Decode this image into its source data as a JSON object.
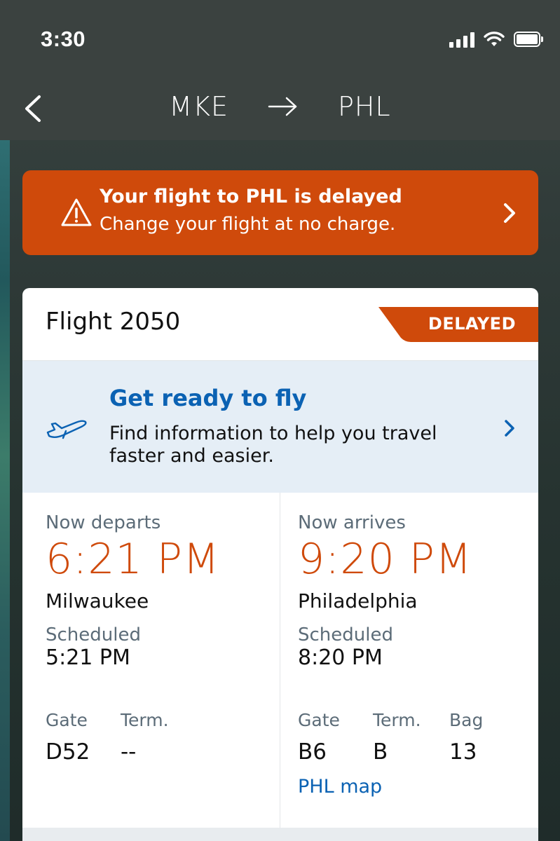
{
  "status_bar": {
    "time": "3:30"
  },
  "nav": {
    "origin": "MKE",
    "destination": "PHL"
  },
  "alert": {
    "title": "Your flight to PHL is delayed",
    "subtitle": "Change your flight at no charge."
  },
  "flight": {
    "number": "Flight 2050",
    "status": "DELAYED"
  },
  "ready": {
    "title": "Get ready to fly",
    "description": "Find information to help you travel faster and easier."
  },
  "departure": {
    "label": "Now departs",
    "time": "6:21 PM",
    "city": "Milwaukee",
    "scheduled_label": "Scheduled",
    "scheduled_time": "5:21 PM",
    "gate_label": "Gate",
    "gate": "D52",
    "term_label": "Term.",
    "term": "--"
  },
  "arrival": {
    "label": "Now arrives",
    "time": "9:20 PM",
    "city": "Philadelphia",
    "scheduled_label": "Scheduled",
    "scheduled_time": "8:20 PM",
    "gate_label": "Gate",
    "gate": "B6",
    "term_label": "Term.",
    "term": "B",
    "bag_label": "Bag",
    "bag": "13",
    "map_link": "PHL map"
  },
  "colors": {
    "accent_orange": "#cf4a0b",
    "link_blue": "#0b62b3",
    "ready_bg": "#e5eef6"
  }
}
